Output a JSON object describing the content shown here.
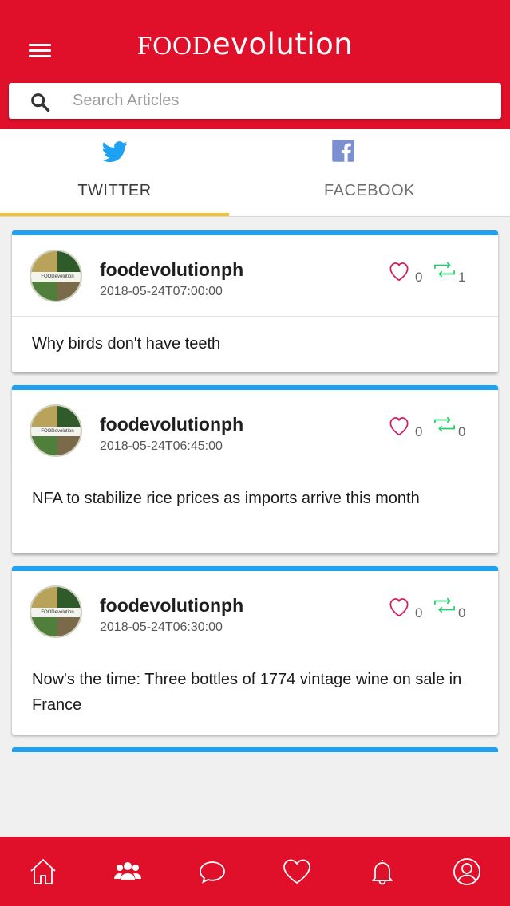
{
  "header": {
    "logo_food": "FOOD",
    "logo_evolution": "evolution",
    "search_placeholder": "Search Articles"
  },
  "tabs": [
    {
      "label": "TWITTER",
      "icon": "twitter-icon",
      "active": true
    },
    {
      "label": "FACEBOOK",
      "icon": "facebook-icon",
      "active": false
    }
  ],
  "posts": [
    {
      "author": "foodevolutionph",
      "date": "2018-05-24T07:00:00",
      "likes": "0",
      "retweets": "1",
      "text": "Why birds don't have teeth"
    },
    {
      "author": "foodevolutionph",
      "date": "2018-05-24T06:45:00",
      "likes": "0",
      "retweets": "0",
      "text": "NFA to stabilize rice prices as imports arrive this month"
    },
    {
      "author": "foodevolutionph",
      "date": "2018-05-24T06:30:00",
      "likes": "0",
      "retweets": "0",
      "text": "Now's the time: Three bottles of 1774 vintage wine on sale in France"
    }
  ],
  "bottom_nav": [
    "home-icon",
    "community-icon",
    "chat-icon",
    "heart-icon",
    "bell-icon",
    "profile-icon"
  ],
  "colors": {
    "brand_red": "#e0102a",
    "twitter_blue": "#1da1f2",
    "tab_indicator": "#f4c430",
    "like_pink": "#d81b60",
    "retweet_green": "#2ecc71",
    "facebook_blue": "#7b8fd1"
  }
}
